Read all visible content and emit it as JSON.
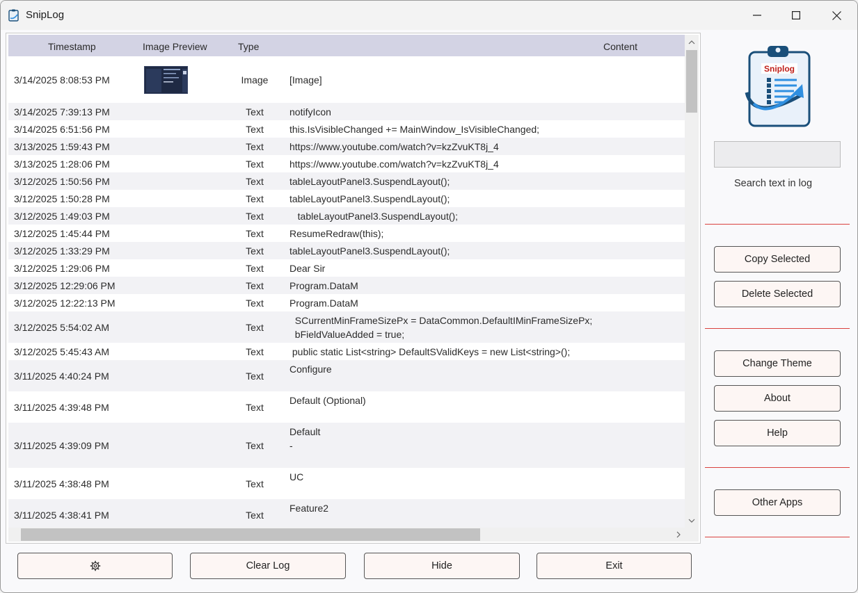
{
  "window": {
    "title": "SnipLog"
  },
  "grid": {
    "columns": [
      "Timestamp",
      "Image Preview",
      "Type",
      "Content"
    ],
    "rows": [
      {
        "timestamp": "3/14/2025 8:08:53 PM",
        "type": "Image",
        "content": "[Image]",
        "has_preview": true
      },
      {
        "timestamp": "3/14/2025 7:39:13 PM",
        "type": "Text",
        "content": "notifyIcon"
      },
      {
        "timestamp": "3/14/2025 6:51:56 PM",
        "type": "Text",
        "content": "this.IsVisibleChanged += MainWindow_IsVisibleChanged;"
      },
      {
        "timestamp": "3/13/2025 1:59:43 PM",
        "type": "Text",
        "content": "https://www.youtube.com/watch?v=kzZvuKT8j_4"
      },
      {
        "timestamp": "3/13/2025 1:28:06 PM",
        "type": "Text",
        "content": "https://www.youtube.com/watch?v=kzZvuKT8j_4"
      },
      {
        "timestamp": "3/12/2025 1:50:56 PM",
        "type": "Text",
        "content": "tableLayoutPanel3.SuspendLayout();"
      },
      {
        "timestamp": "3/12/2025 1:50:28 PM",
        "type": "Text",
        "content": "tableLayoutPanel3.SuspendLayout();"
      },
      {
        "timestamp": "3/12/2025 1:49:03 PM",
        "type": "Text",
        "content": "   tableLayoutPanel3.SuspendLayout();"
      },
      {
        "timestamp": "3/12/2025 1:45:44 PM",
        "type": "Text",
        "content": "ResumeRedraw(this);"
      },
      {
        "timestamp": "3/12/2025 1:33:29 PM",
        "type": "Text",
        "content": "tableLayoutPanel3.SuspendLayout();"
      },
      {
        "timestamp": "3/12/2025 1:29:06 PM",
        "type": "Text",
        "content": "Dear Sir"
      },
      {
        "timestamp": "3/12/2025 12:29:06 PM",
        "type": "Text",
        "content": "Program.DataM"
      },
      {
        "timestamp": "3/12/2025 12:22:13 PM",
        "type": "Text",
        "content": "Program.DataM"
      },
      {
        "timestamp": "3/12/2025 5:54:02 AM",
        "type": "Text",
        "content": "  SCurrentMinFrameSizePx = DataCommon.DefaultIMinFrameSizePx;\n  bFieldValueAdded = true;"
      },
      {
        "timestamp": "3/12/2025 5:45:43 AM",
        "type": "Text",
        "content": " public static List<string> DefaultSValidKeys = new List<string>();"
      },
      {
        "timestamp": "3/11/2025 4:40:24 PM",
        "type": "Text",
        "content": "Configure"
      },
      {
        "timestamp": "3/11/2025 4:39:48 PM",
        "type": "Text",
        "content": "Default (Optional)"
      },
      {
        "timestamp": "3/11/2025 4:39:09 PM",
        "type": "Text",
        "content": "Default\n-"
      },
      {
        "timestamp": "3/11/2025 4:38:48 PM",
        "type": "Text",
        "content": "UC"
      },
      {
        "timestamp": "3/11/2025 4:38:41 PM",
        "type": "Text",
        "content": "Feature2"
      }
    ]
  },
  "sidebar": {
    "logo_text": "Sniplog",
    "search": {
      "value": "",
      "label": "Search text in log"
    },
    "buttons": {
      "copy_selected": "Copy Selected",
      "delete_selected": "Delete Selected",
      "change_theme": "Change Theme",
      "about": "About",
      "help": "Help",
      "other_apps": "Other Apps"
    }
  },
  "bottom_buttons": {
    "settings_icon": "gear-icon",
    "clear_log": "Clear Log",
    "hide": "Hide",
    "exit": "Exit"
  },
  "colors": {
    "header_bg": "#d3d3e4",
    "separator": "#d9413e",
    "button_bg": "#fdf6f4",
    "logo_blue": "#1a4f7a",
    "logo_red": "#c0201b"
  }
}
